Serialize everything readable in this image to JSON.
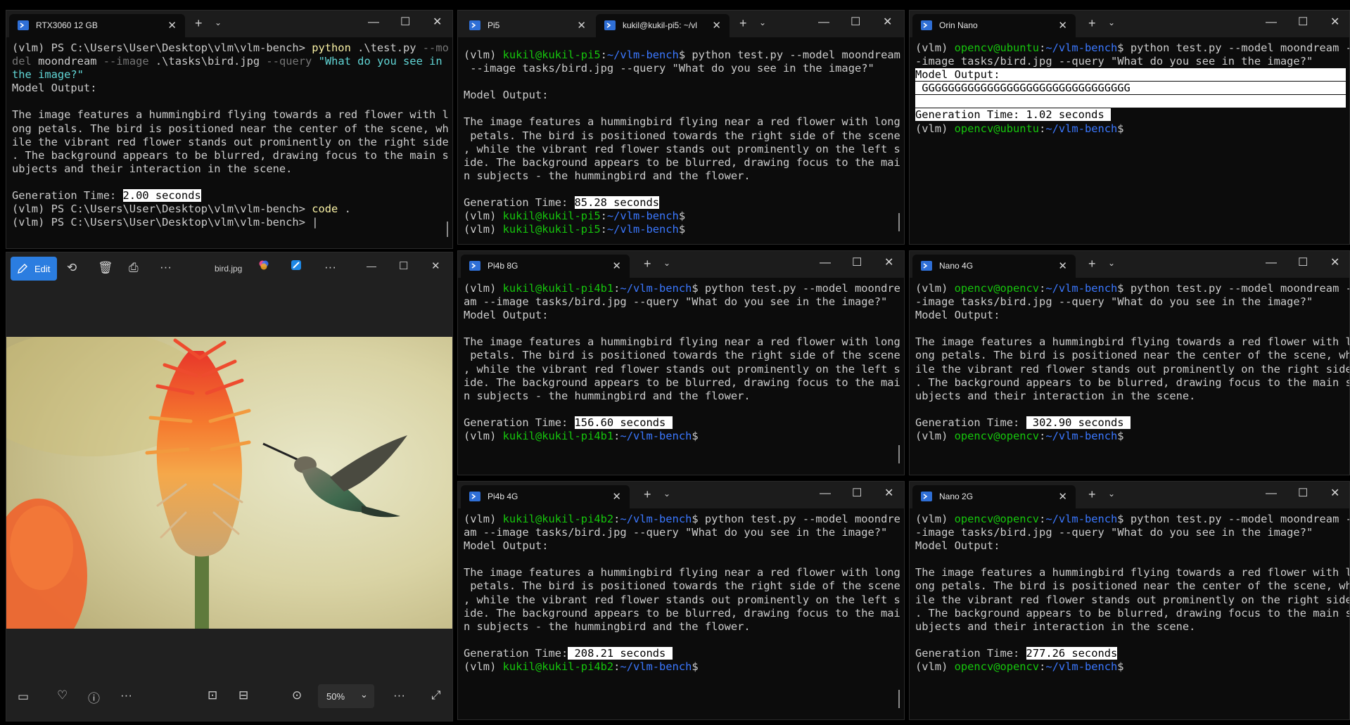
{
  "windows": {
    "rtx": {
      "tab_label": "RTX3060 12 GB",
      "lines": [
        [
          [
            "(vlm) PS C:\\Users\\User\\Desktop\\vlm\\vlm-bench> ",
            ""
          ],
          [
            "python",
            "y"
          ],
          [
            " .\\test.py ",
            ""
          ],
          [
            "--mo",
            "gray"
          ]
        ],
        [
          [
            "del",
            "gray"
          ],
          [
            " moondream ",
            ""
          ],
          [
            "--image",
            "gray"
          ],
          [
            " .\\tasks\\bird.jpg ",
            ""
          ],
          [
            "--query",
            "gray"
          ],
          [
            " ",
            ""
          ],
          [
            "\"What do you see in",
            "c"
          ]
        ],
        [
          [
            "the image?\"",
            "c"
          ]
        ],
        [
          [
            "Model Output:",
            ""
          ]
        ],
        [
          [
            "",
            ""
          ]
        ],
        [
          [
            "The image features a hummingbird flying towards a red flower with l",
            ""
          ]
        ],
        [
          [
            "ong petals. The bird is positioned near the center of the scene, wh",
            ""
          ]
        ],
        [
          [
            "ile the vibrant red flower stands out prominently on the right side",
            ""
          ]
        ],
        [
          [
            ". The background appears to be blurred, drawing focus to the main s",
            ""
          ]
        ],
        [
          [
            "ubjects and their interaction in the scene.",
            ""
          ]
        ],
        [
          [
            "",
            ""
          ]
        ],
        [
          [
            "Generation Time: ",
            ""
          ],
          [
            "2.00 seconds",
            "hl"
          ]
        ],
        [
          [
            "(vlm) PS C:\\Users\\User\\Desktop\\vlm\\vlm-bench> ",
            ""
          ],
          [
            "code",
            "y"
          ],
          [
            " .",
            ""
          ]
        ],
        [
          [
            "(vlm) PS C:\\Users\\User\\Desktop\\vlm\\vlm-bench> |",
            ""
          ]
        ]
      ]
    },
    "pi5": {
      "tab1_label": "Pi5",
      "tab2_label": "kukil@kukil-pi5: ~/vl",
      "lines": [
        [
          [
            "(vlm) ",
            ""
          ],
          [
            "kukil@kukil-pi5",
            "g"
          ],
          [
            ":",
            ""
          ],
          [
            "~/vlm-bench",
            "b"
          ],
          [
            "$ python test.py --model moondream",
            ""
          ]
        ],
        [
          [
            " --image tasks/bird.jpg --query \"What do you see in the image?\"",
            ""
          ]
        ],
        [
          [
            "",
            ""
          ]
        ],
        [
          [
            "Model Output:",
            ""
          ]
        ],
        [
          [
            "",
            ""
          ]
        ],
        [
          [
            "The image features a hummingbird flying near a red flower with long",
            ""
          ]
        ],
        [
          [
            " petals. The bird is positioned towards the right side of the scene",
            ""
          ]
        ],
        [
          [
            ", while the vibrant red flower stands out prominently on the left s",
            ""
          ]
        ],
        [
          [
            "ide. The background appears to be blurred, drawing focus to the mai",
            ""
          ]
        ],
        [
          [
            "n subjects - the hummingbird and the flower.",
            ""
          ]
        ],
        [
          [
            "",
            ""
          ]
        ],
        [
          [
            "Generation Time: ",
            ""
          ],
          [
            "85.28 seconds",
            "hl"
          ]
        ],
        [
          [
            "(vlm) ",
            ""
          ],
          [
            "kukil@kukil-pi5",
            "g"
          ],
          [
            ":",
            ""
          ],
          [
            "~/vlm-bench",
            "b"
          ],
          [
            "$",
            ""
          ]
        ],
        [
          [
            "(vlm) ",
            ""
          ],
          [
            "kukil@kukil-pi5",
            "g"
          ],
          [
            ":",
            ""
          ],
          [
            "~/vlm-bench",
            "b"
          ],
          [
            "$",
            ""
          ]
        ]
      ]
    },
    "orin": {
      "tab_label": "Orin Nano",
      "lines": [
        [
          [
            "(vlm) ",
            ""
          ],
          [
            "opencv@ubuntu",
            "g"
          ],
          [
            ":",
            ""
          ],
          [
            "~/vlm-bench",
            "b"
          ],
          [
            "$ python test.py --model moondream -",
            ""
          ]
        ],
        [
          [
            "-image tasks/bird.jpg --query \"What do you see in the image?\"",
            ""
          ]
        ],
        [
          [
            "Model Output:                                                     ",
            "hl"
          ]
        ],
        [
          [
            " GGGGGGGGGGGGGGGGGGGGGGGGGGGGGGGG                                 ",
            "hl"
          ]
        ],
        [
          [
            "                                                                  ",
            "hl"
          ]
        ],
        [
          [
            "Generation Time: 1.02 seconds ",
            "hl"
          ]
        ],
        [
          [
            "(vlm) ",
            ""
          ],
          [
            "opencv@ubuntu",
            "g"
          ],
          [
            ":",
            ""
          ],
          [
            "~/vlm-bench",
            "b"
          ],
          [
            "$",
            ""
          ]
        ]
      ]
    },
    "pi4b8": {
      "tab_label": "Pi4b 8G",
      "lines": [
        [
          [
            "(vlm) ",
            ""
          ],
          [
            "kukil@kukil-pi4b1",
            "g"
          ],
          [
            ":",
            ""
          ],
          [
            "~/vlm-bench",
            "b"
          ],
          [
            "$ python test.py --model moondre",
            ""
          ]
        ],
        [
          [
            "am --image tasks/bird.jpg --query \"What do you see in the image?\"",
            ""
          ]
        ],
        [
          [
            "Model Output:",
            ""
          ]
        ],
        [
          [
            "",
            ""
          ]
        ],
        [
          [
            "The image features a hummingbird flying near a red flower with long",
            ""
          ]
        ],
        [
          [
            " petals. The bird is positioned towards the right side of the scene",
            ""
          ]
        ],
        [
          [
            ", while the vibrant red flower stands out prominently on the left s",
            ""
          ]
        ],
        [
          [
            "ide. The background appears to be blurred, drawing focus to the mai",
            ""
          ]
        ],
        [
          [
            "n subjects - the hummingbird and the flower.",
            ""
          ]
        ],
        [
          [
            "",
            ""
          ]
        ],
        [
          [
            "Generation Time: ",
            ""
          ],
          [
            "156.60 seconds ",
            "hl"
          ]
        ],
        [
          [
            "(vlm) ",
            ""
          ],
          [
            "kukil@kukil-pi4b1",
            "g"
          ],
          [
            ":",
            ""
          ],
          [
            "~/vlm-bench",
            "b"
          ],
          [
            "$",
            ""
          ]
        ]
      ]
    },
    "nano4": {
      "tab_label": "Nano 4G",
      "lines": [
        [
          [
            "(vlm) ",
            ""
          ],
          [
            "opencv@opencv",
            "g"
          ],
          [
            ":",
            ""
          ],
          [
            "~/vlm-bench",
            "b"
          ],
          [
            "$ python test.py --model moondream -",
            ""
          ]
        ],
        [
          [
            "-image tasks/bird.jpg --query \"What do you see in the image?\"",
            ""
          ]
        ],
        [
          [
            "Model Output:",
            ""
          ]
        ],
        [
          [
            "",
            ""
          ]
        ],
        [
          [
            "The image features a hummingbird flying towards a red flower with l",
            ""
          ]
        ],
        [
          [
            "ong petals. The bird is positioned near the center of the scene, wh",
            ""
          ]
        ],
        [
          [
            "ile the vibrant red flower stands out prominently on the right side",
            ""
          ]
        ],
        [
          [
            ". The background appears to be blurred, drawing focus to the main s",
            ""
          ]
        ],
        [
          [
            "ubjects and their interaction in the scene.",
            ""
          ]
        ],
        [
          [
            "",
            ""
          ]
        ],
        [
          [
            "Generation Time: ",
            ""
          ],
          [
            " 302.90 seconds ",
            "hl"
          ]
        ],
        [
          [
            "(vlm) ",
            ""
          ],
          [
            "opencv@opencv",
            "g"
          ],
          [
            ":",
            ""
          ],
          [
            "~/vlm-bench",
            "b"
          ],
          [
            "$",
            ""
          ]
        ]
      ]
    },
    "pi4b4": {
      "tab_label": "Pi4b 4G",
      "lines": [
        [
          [
            "(vlm) ",
            ""
          ],
          [
            "kukil@kukil-pi4b2",
            "g"
          ],
          [
            ":",
            ""
          ],
          [
            "~/vlm-bench",
            "b"
          ],
          [
            "$ python test.py --model moondre",
            ""
          ]
        ],
        [
          [
            "am --image tasks/bird.jpg --query \"What do you see in the image?\"",
            ""
          ]
        ],
        [
          [
            "Model Output:",
            ""
          ]
        ],
        [
          [
            "",
            ""
          ]
        ],
        [
          [
            "The image features a hummingbird flying near a red flower with long",
            ""
          ]
        ],
        [
          [
            " petals. The bird is positioned towards the right side of the scene",
            ""
          ]
        ],
        [
          [
            ", while the vibrant red flower stands out prominently on the left s",
            ""
          ]
        ],
        [
          [
            "ide. The background appears to be blurred, drawing focus to the mai",
            ""
          ]
        ],
        [
          [
            "n subjects - the hummingbird and the flower.",
            ""
          ]
        ],
        [
          [
            "",
            ""
          ]
        ],
        [
          [
            "Generation Time:",
            ""
          ],
          [
            " 208.21 seconds ",
            "hl"
          ]
        ],
        [
          [
            "(vlm) ",
            ""
          ],
          [
            "kukil@kukil-pi4b2",
            "g"
          ],
          [
            ":",
            ""
          ],
          [
            "~/vlm-bench",
            "b"
          ],
          [
            "$",
            ""
          ]
        ]
      ]
    },
    "nano2": {
      "tab_label": "Nano 2G",
      "lines": [
        [
          [
            "(vlm) ",
            ""
          ],
          [
            "opencv@opencv",
            "g"
          ],
          [
            ":",
            ""
          ],
          [
            "~/vlm-bench",
            "b"
          ],
          [
            "$ python test.py --model moondream -",
            ""
          ]
        ],
        [
          [
            "-image tasks/bird.jpg --query \"What do you see in the image?\"",
            ""
          ]
        ],
        [
          [
            "Model Output:",
            ""
          ]
        ],
        [
          [
            "",
            ""
          ]
        ],
        [
          [
            "The image features a hummingbird flying towards a red flower with l",
            ""
          ]
        ],
        [
          [
            "ong petals. The bird is positioned near the center of the scene, wh",
            ""
          ]
        ],
        [
          [
            "ile the vibrant red flower stands out prominently on the right side",
            ""
          ]
        ],
        [
          [
            ". The background appears to be blurred, drawing focus to the main s",
            ""
          ]
        ],
        [
          [
            "ubjects and their interaction in the scene.",
            ""
          ]
        ],
        [
          [
            "",
            ""
          ]
        ],
        [
          [
            "Generation Time: ",
            ""
          ],
          [
            "277.26 seconds",
            "hl"
          ]
        ],
        [
          [
            "(vlm) ",
            ""
          ],
          [
            "opencv@opencv",
            "g"
          ],
          [
            ":",
            ""
          ],
          [
            "~/vlm-bench",
            "b"
          ],
          [
            "$",
            ""
          ]
        ]
      ]
    }
  },
  "photos": {
    "edit_label": "Edit",
    "file_name": "bird.jpg",
    "zoom_value": "50%"
  },
  "icons": {
    "new_tab": "+",
    "dropdown": "⌄",
    "close": "✕",
    "minimize": "—",
    "maximize": "☐",
    "more": "···"
  }
}
